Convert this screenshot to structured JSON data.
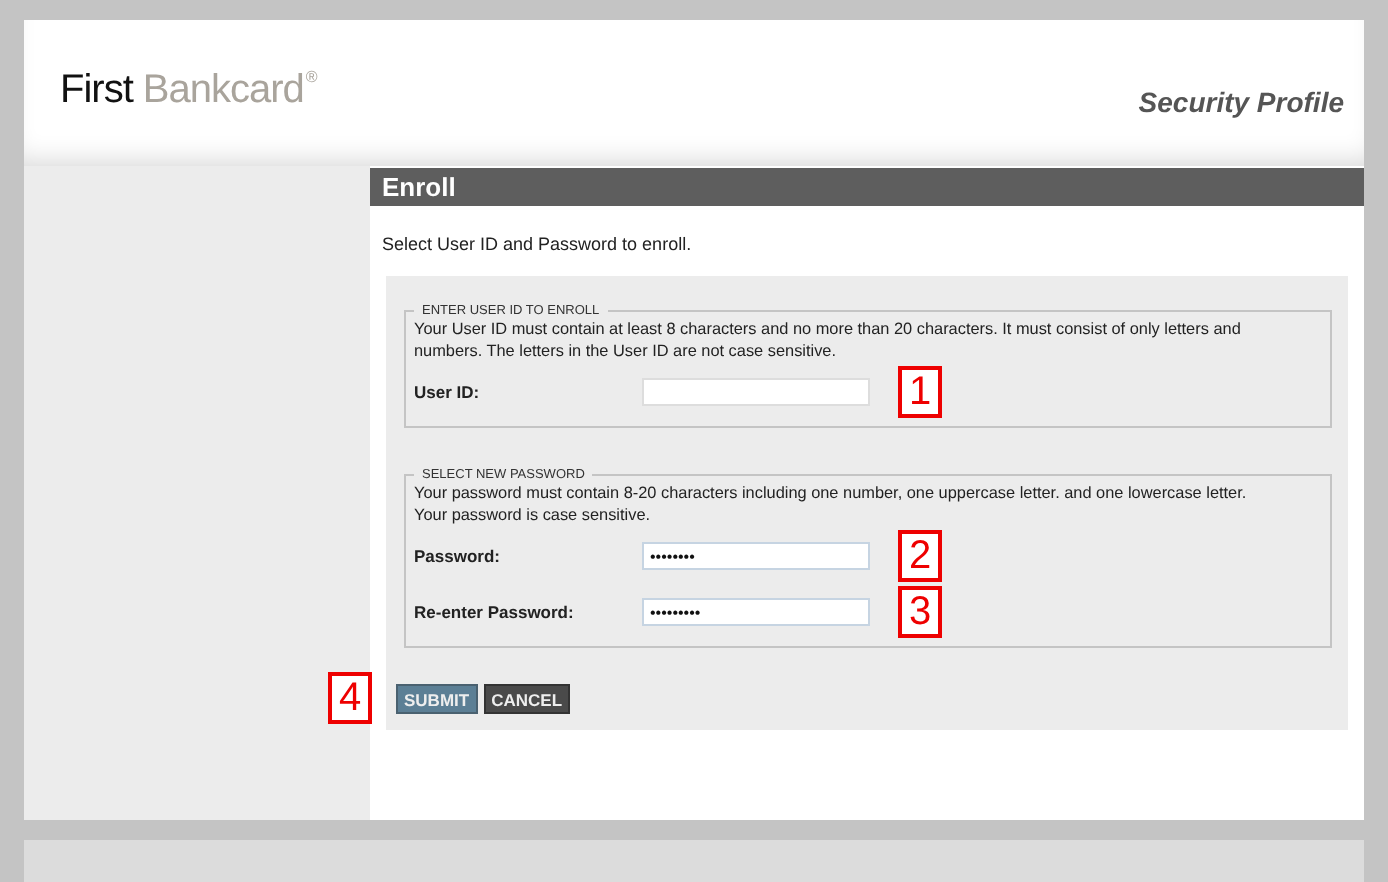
{
  "header": {
    "brand_primary": "First",
    "brand_secondary": "Bankcard",
    "brand_mark": "®",
    "title": "Security Profile"
  },
  "section": {
    "title": "Enroll",
    "intro": "Select User ID and Password to enroll."
  },
  "fieldsets": [
    {
      "legend": "ENTER USER ID TO ENROLL",
      "description": "Your User ID must contain at least 8 characters and no more than 20 characters. It must consist of only letters and numbers. The letters in the User ID are not case sensitive.",
      "fields": [
        {
          "label": "User ID:",
          "callout": "1"
        }
      ]
    },
    {
      "legend": "SELECT NEW PASSWORD",
      "description": "Your password must contain 8-20 characters including one number, one uppercase letter. and one lowercase letter. Your password is case sensitive.",
      "fields": [
        {
          "label": "Password:",
          "value": "••••••••",
          "callout": "2"
        },
        {
          "label": "Re-enter Password:",
          "value": "•••••••••",
          "callout": "3"
        }
      ]
    }
  ],
  "buttons": [
    {
      "label": "SUBMIT",
      "kind": "primary"
    },
    {
      "label": "CANCEL",
      "kind": "secondary"
    }
  ],
  "buttons_callout": "4"
}
